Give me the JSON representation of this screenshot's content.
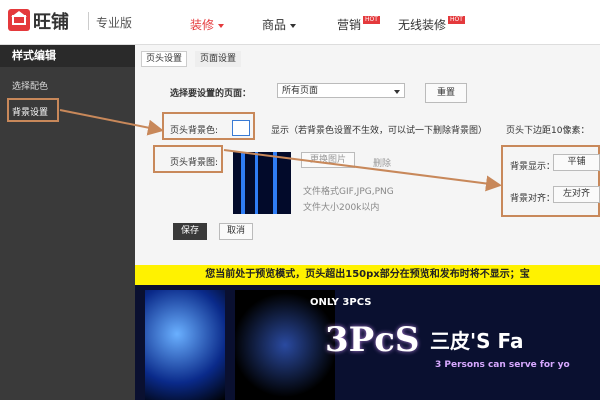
{
  "header": {
    "brand": "旺铺",
    "edition": "专业版",
    "nav": [
      {
        "label": "装修",
        "active": true,
        "hot": ""
      },
      {
        "label": "商品",
        "active": false,
        "hot": ""
      },
      {
        "label": "营销",
        "active": false,
        "hot": "HOT"
      },
      {
        "label": "无线装修",
        "active": false,
        "hot": "HOT"
      }
    ]
  },
  "sidebar": {
    "title": "样式编辑",
    "items": [
      "选择配色",
      "背景设置"
    ]
  },
  "main": {
    "tabs": [
      "页头设置",
      "页面设置"
    ],
    "page_select_label": "选择要设置的页面：",
    "page_select_value": "所有页面",
    "reset_button": "重置",
    "bg_color_label": "页头背景色:",
    "display_label": "显示（若背景色设置不生效，可以试一下删除背景图）",
    "margin_label": "页头下边距10像素：",
    "bg_image_label": "页头背景图:",
    "change_image_button": "更换图片",
    "delete_label": "删除",
    "bg_display_label": "背景显示：",
    "bg_display_value": "平铺",
    "bg_align_label": "背景对齐：",
    "bg_align_value": "左对齐",
    "file_format_note": "文件格式GIF,JPG,PNG",
    "file_size_note": "文件大小200k以内",
    "save_button": "保存",
    "cancel_button": "取消"
  },
  "preview": {
    "notice": "您当前处于预览模式，页头超出150px部分在预览和发布时将不显示；宝",
    "only": "ONLY 3PCS",
    "pcs": "3PcS",
    "cn_brand": "三皮'S Fa",
    "en_brand": "3 Persons can serve for yo"
  },
  "colors": {
    "accent": "#e4393c",
    "highlight": "#c8885a",
    "sidebar": "#3a3a3a",
    "notice": "#fff200"
  }
}
